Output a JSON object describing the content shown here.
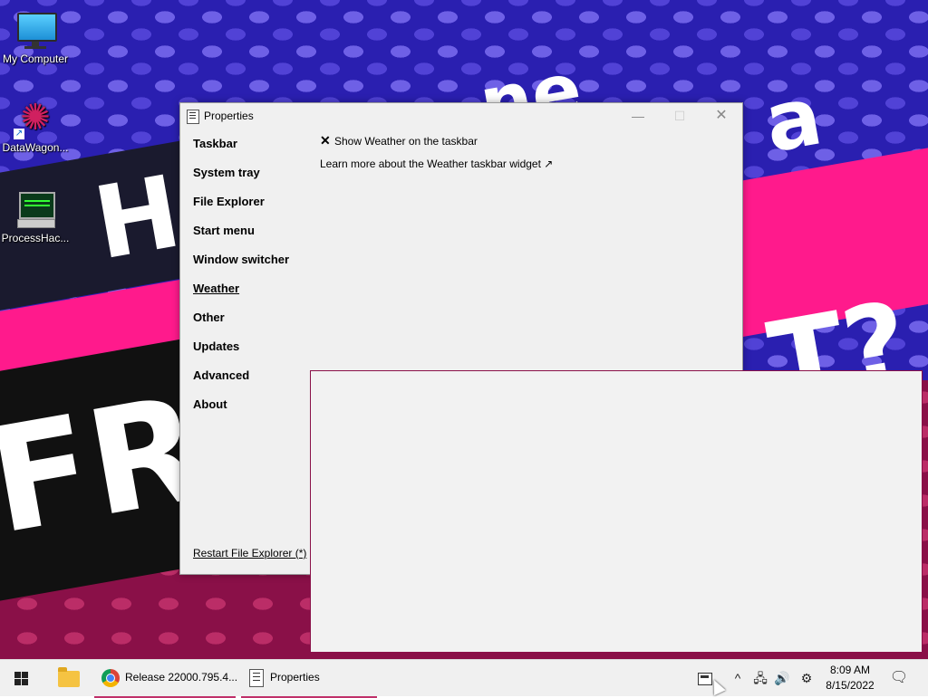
{
  "desktop": {
    "icons": [
      {
        "label": "My Computer",
        "icon": "monitor-icon"
      },
      {
        "label": "DataWagon...",
        "icon": "datawagon-icon"
      },
      {
        "label": "ProcessHac...",
        "icon": "processhacker-icon"
      }
    ],
    "wallpaper_text": [
      "He",
      "FR",
      "a",
      "T?",
      "ne"
    ]
  },
  "window": {
    "title": "Properties",
    "controls": {
      "minimize": "—",
      "maximize": "☐",
      "close": "✕"
    },
    "nav": [
      {
        "label": "Taskbar"
      },
      {
        "label": "System tray"
      },
      {
        "label": "File Explorer"
      },
      {
        "label": "Start menu"
      },
      {
        "label": "Window switcher"
      },
      {
        "label": "Weather",
        "active": true
      },
      {
        "label": "Other"
      },
      {
        "label": "Updates"
      },
      {
        "label": "Advanced"
      },
      {
        "label": "About"
      }
    ],
    "content": {
      "option_mark": "✕",
      "option_label": "Show Weather on the taskbar",
      "link_label": "Learn more about the Weather taskbar widget ↗"
    },
    "restart_label": "Restart File Explorer (*)"
  },
  "taskbar": {
    "chrome_label": "Release 22000.795.4...",
    "properties_label": "Properties",
    "tray": {
      "chevron": "^",
      "network": "🖧",
      "volume": "🔊",
      "settings": "⚙",
      "notifications": "🗨"
    },
    "clock": {
      "time": "8:09 AM",
      "date": "8/15/2022"
    }
  },
  "colors": {
    "wallpaper_blue": "#2a1fb0",
    "wallpaper_pink": "#ff1a8c",
    "wallpaper_dark": "#8a1048",
    "window_bg": "#f0f0f0",
    "taskbar_bg": "#f0f0f0"
  }
}
